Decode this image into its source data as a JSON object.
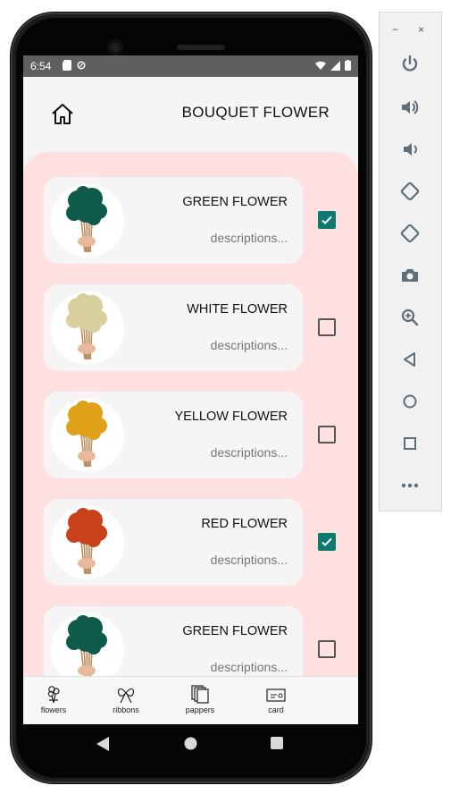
{
  "status_bar": {
    "time": "6:54"
  },
  "app": {
    "title": "BOUQUET FLOWER"
  },
  "flowers": [
    {
      "name": "GREEN FLOWER",
      "description": "descriptions...",
      "checked": true,
      "color": "#0f5a4a"
    },
    {
      "name": "WHITE FLOWER",
      "description": "descriptions...",
      "checked": false,
      "color": "#d8cf9c"
    },
    {
      "name": "YELLOW FLOWER",
      "description": "descriptions...",
      "checked": false,
      "color": "#e0a11a"
    },
    {
      "name": "RED FLOWER",
      "description": "descriptions...",
      "checked": true,
      "color": "#c8401c"
    },
    {
      "name": "GREEN FLOWER",
      "description": "descriptions...",
      "checked": false,
      "color": "#0f5a4a"
    }
  ],
  "bottom_nav": [
    {
      "label": "flowers",
      "icon": "bouquet-icon"
    },
    {
      "label": "ribbons",
      "icon": "ribbon-icon"
    },
    {
      "label": "pappers",
      "icon": "paper-icon"
    },
    {
      "label": "card",
      "icon": "card-icon"
    }
  ],
  "emulator_toolbar": {
    "window_controls": [
      "−",
      "×"
    ],
    "buttons": [
      "power-icon",
      "volume-up-icon",
      "volume-down-icon",
      "rotate-left-icon",
      "rotate-right-icon",
      "camera-icon",
      "zoom-icon",
      "back-icon",
      "home-icon",
      "overview-icon",
      "more-icon"
    ]
  },
  "colors": {
    "accent": "#0d7a6f",
    "panel": "#fde0df"
  }
}
